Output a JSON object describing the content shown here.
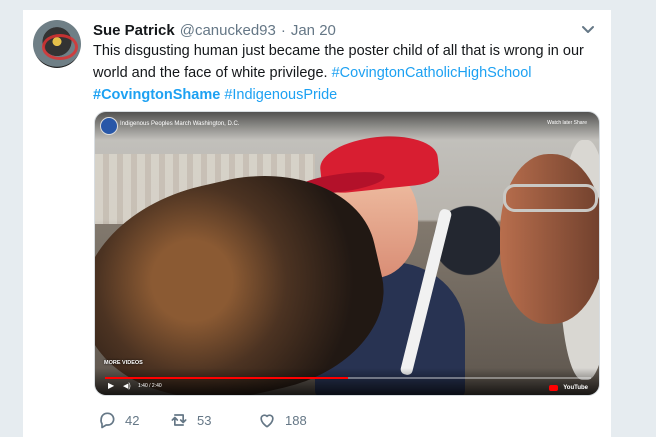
{
  "tweet": {
    "author_name": "Sue Patrick",
    "handle": "@canucked93",
    "separator": "·",
    "date": "Jan 20",
    "text_line_1": "This disgusting human just became the poster child of all that is wrong in our",
    "text_line_2_prefix": "world and the face of white privilege.",
    "hashtag_1": "#CovingtonCatholicHighSchool",
    "hashtag_2": "#CovingtonShame",
    "hashtag_3": "#IndigenousPride",
    "replies": "42",
    "retweets": "53",
    "likes": "188"
  },
  "video": {
    "title": "Indigenous Peoples March Washington, D.C.",
    "top_actions": "Watch later   Share",
    "more_videos": "MORE VIDEOS",
    "time": "1:40 / 2:40",
    "brand": "YouTube",
    "progress": 0.5
  },
  "colors": {
    "link": "#1da1f2",
    "secondary_text": "#657786",
    "video_progress": "#ff0000"
  },
  "icons": {
    "chevron": "chevron-down-icon",
    "reply": "reply-icon",
    "retweet": "retweet-icon",
    "like": "heart-icon"
  }
}
